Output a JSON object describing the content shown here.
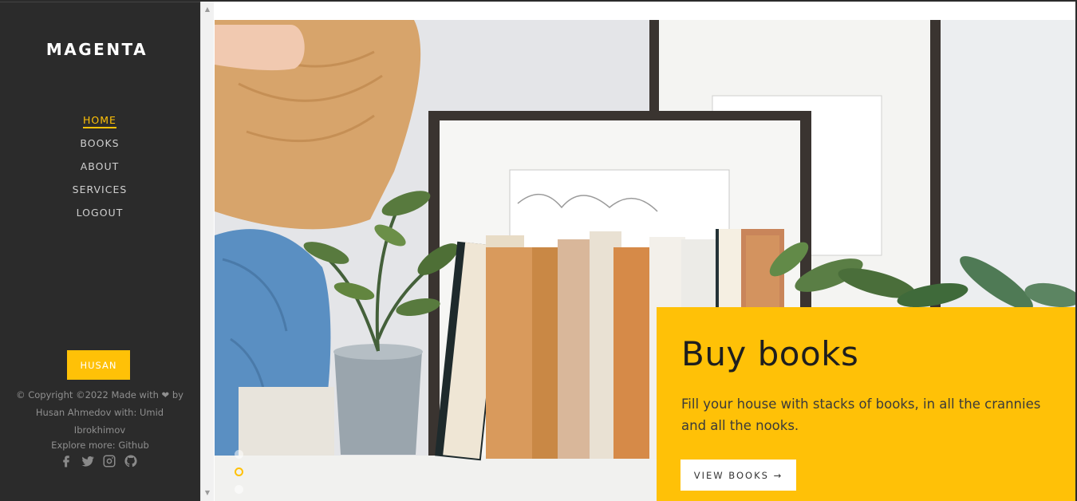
{
  "brand": "MAGENTA",
  "nav": [
    {
      "label": "HOME",
      "active": true
    },
    {
      "label": "BOOKS",
      "active": false
    },
    {
      "label": "ABOUT",
      "active": false
    },
    {
      "label": "SERVICES",
      "active": false
    },
    {
      "label": "LOGOUT",
      "active": false
    }
  ],
  "user_button": "HUSAN",
  "footer": {
    "copyright": "© Copyright ©2022 Made with ❤ by Husan Ahmedov with: Umid Ibrokhimov",
    "explore_prefix": "Explore more: ",
    "explore_link": "Github",
    "socials": [
      "facebook-icon",
      "twitter-icon",
      "instagram-icon",
      "github-icon"
    ]
  },
  "hero": {
    "title": "Buy books",
    "description": "Fill your house with stacks of books, in all the crannies and all the nooks.",
    "button_label": "VIEW BOOKS",
    "button_arrow": "→",
    "slides": 3,
    "active_slide": 1
  },
  "colors": {
    "accent": "#ffc107",
    "sidebar_bg": "#2b2b2b",
    "muted_text": "#8f8f8f"
  }
}
